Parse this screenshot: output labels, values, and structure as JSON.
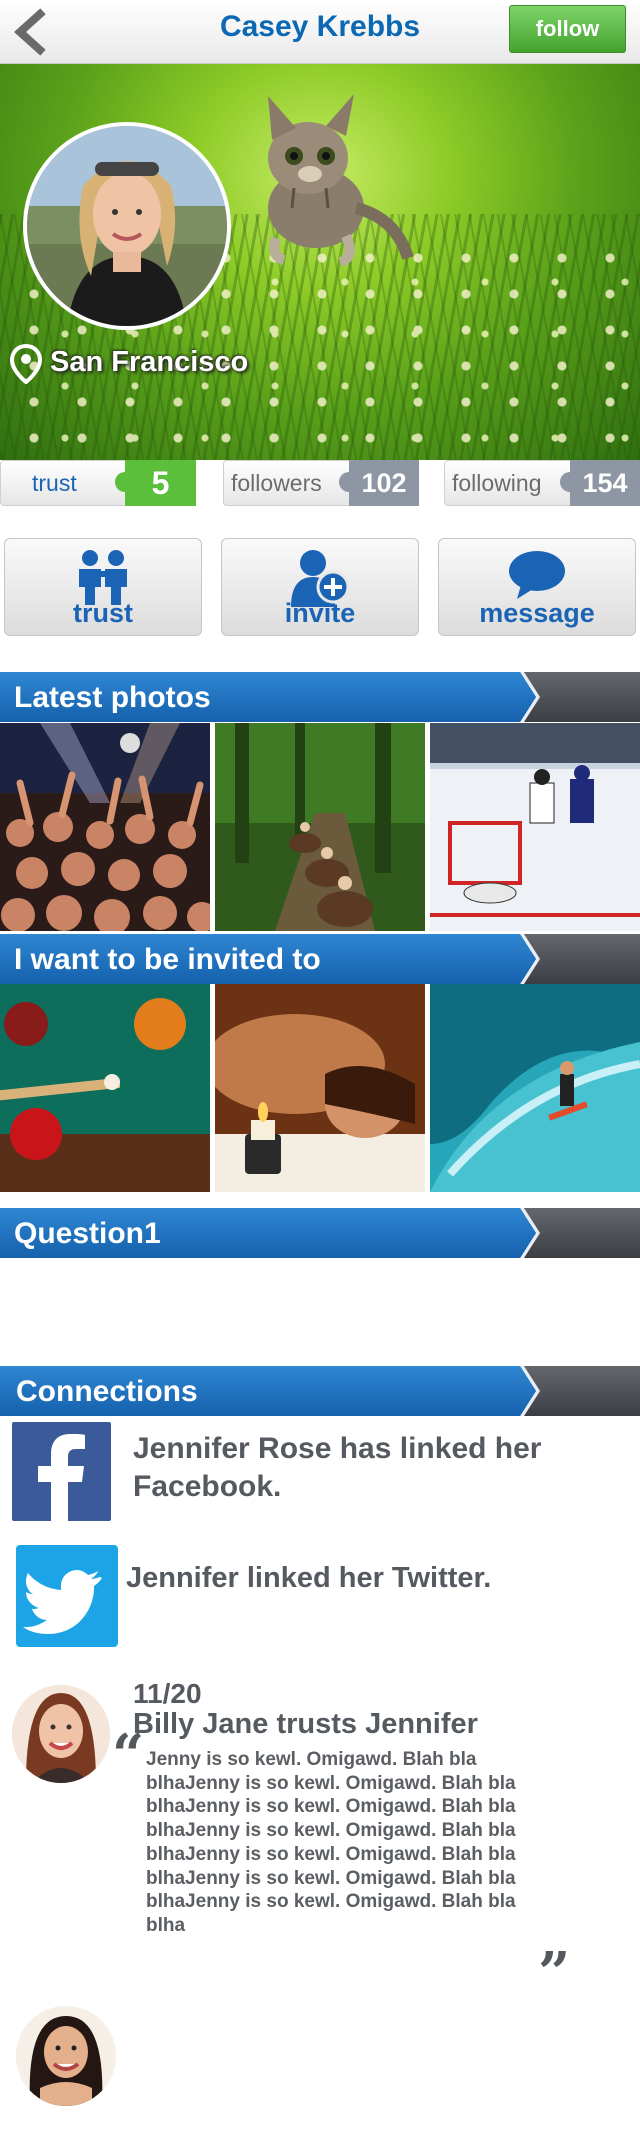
{
  "header": {
    "title": "Casey Krebbs",
    "follow_label": "follow"
  },
  "profile": {
    "location": "San Francisco"
  },
  "stats": [
    {
      "label": "trust",
      "count": "5",
      "color": "#5cbf3b"
    },
    {
      "label": "followers",
      "count": "102",
      "color": "#8e96a3"
    },
    {
      "label": "following",
      "count": "154",
      "color": "#8e96a3"
    }
  ],
  "actions": [
    {
      "label": "trust",
      "icon": "two-people-icon"
    },
    {
      "label": "invite",
      "icon": "add-person-icon"
    },
    {
      "label": "message",
      "icon": "speech-bubble-icon"
    }
  ],
  "sections": {
    "latest_photos": "Latest photos",
    "invited_to": "I want to be invited to",
    "question": "Question1",
    "connections": "Connections"
  },
  "latest_photos": [
    "concert-crowd-photo",
    "horseback-trail-photo",
    "ice-hockey-photo"
  ],
  "invited_photos": [
    "billiards-photo",
    "spa-massage-photo",
    "surfing-photo"
  ],
  "connections": {
    "facebook_text": "Jennifer Rose has linked her Facebook.",
    "twitter_text": "Jennifer linked her Twitter.",
    "trust_date": "11/20",
    "trust_headline": "Billy Jane trusts Jennifer",
    "trust_quote": "Jenny is so kewl. Omigawd. Blah bla blhaJenny is so kewl. Omigawd. Blah bla blhaJenny is so kewl. Omigawd. Blah bla blhaJenny is so kewl. Omigawd. Blah bla blhaJenny is so kewl. Omigawd. Blah bla blhaJenny is so kewl. Omigawd. Blah bla blhaJenny is so kewl. Omigawd. Blah bla blha"
  },
  "colors": {
    "brand_blue": "#1b64b5",
    "follow_green": "#44a32f",
    "facebook": "#3b5a9a",
    "twitter": "#1da4e6"
  }
}
